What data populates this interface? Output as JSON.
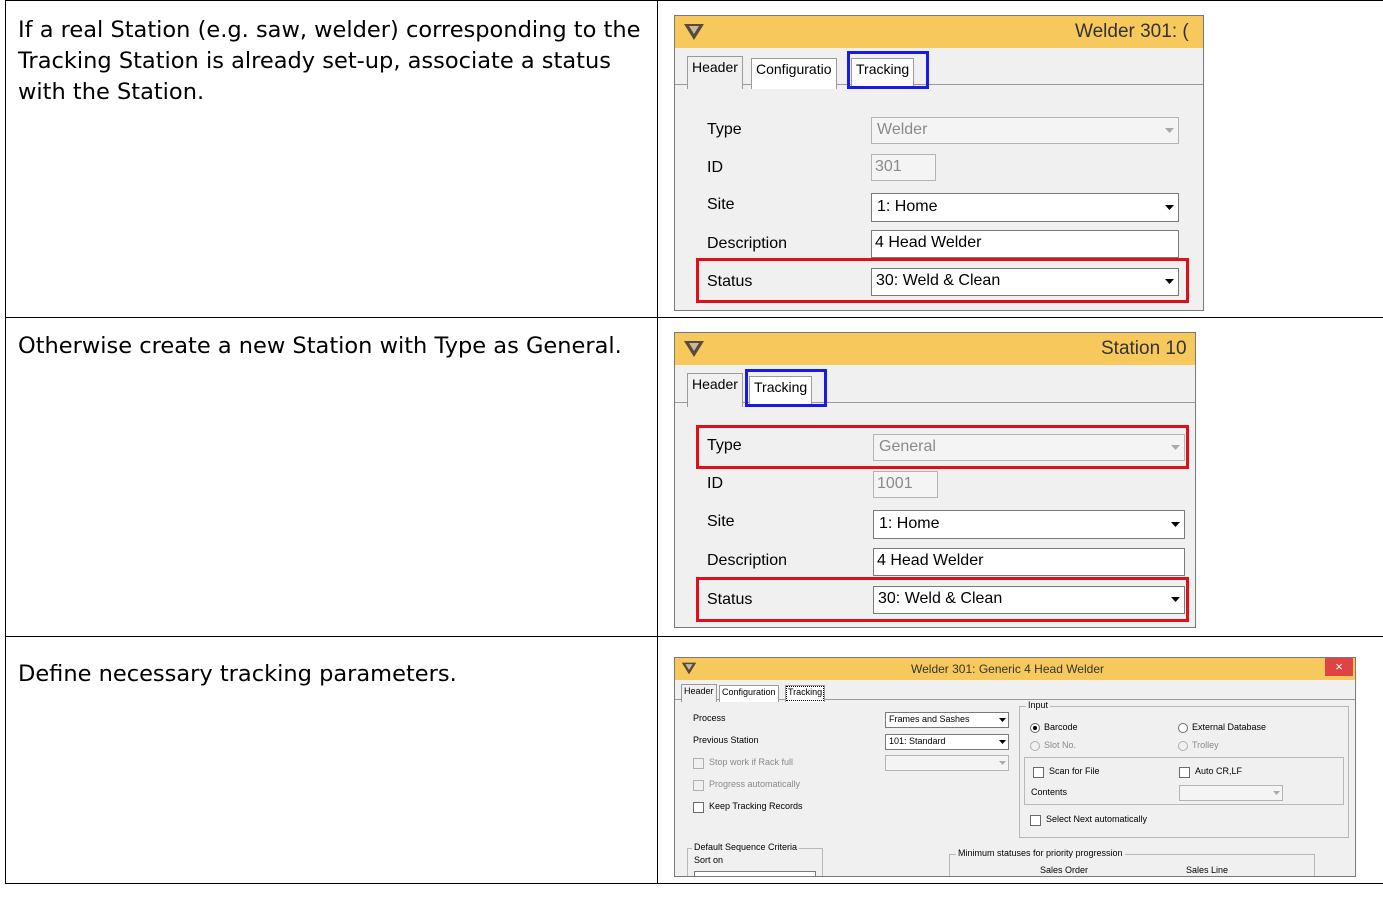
{
  "rows": [
    {
      "text": "If a real Station (e.g. saw, welder) corresponding to the Tracking Station is already set-up, associate a status with the Station.",
      "window": {
        "title": "Welder 301: (",
        "tabs": [
          "Header",
          "Configuratio",
          "Tracking"
        ],
        "labels": {
          "type": "Type",
          "id": "ID",
          "site": "Site",
          "description": "Description",
          "status": "Status"
        },
        "values": {
          "type": "Welder",
          "id": "301",
          "site": "1: Home",
          "description": "4 Head Welder",
          "status": "30: Weld & Clean"
        }
      }
    },
    {
      "text": "Otherwise create a new Station with Type as General.",
      "window": {
        "title": "Station 10",
        "tabs": [
          "Header",
          "Tracking"
        ],
        "labels": {
          "type": "Type",
          "id": "ID",
          "site": "Site",
          "description": "Description",
          "status": "Status"
        },
        "values": {
          "type": "General",
          "id": "1001",
          "site": "1: Home",
          "description": "4 Head Welder",
          "status": "30: Weld & Clean"
        }
      }
    },
    {
      "text": "Define necessary tracking parameters.",
      "window": {
        "title": "Welder 301: Generic 4 Head Welder",
        "close": "×",
        "tabs": [
          "Header",
          "Configuration",
          "Tracking"
        ],
        "process_label": "Process",
        "process_value": "Frames and Sashes",
        "previous_station_label": "Previous Station",
        "previous_station_value": "101: Standard",
        "stop_work": "Stop work if Rack full",
        "progress_auto": "Progress automatically",
        "keep_records": "Keep Tracking Records",
        "input_group": "Input",
        "barcode": "Barcode",
        "external_db": "External Database",
        "slot_no": "Slot No.",
        "trolley": "Trolley",
        "scan_for_file": "Scan for File",
        "auto_crlf": "Auto CR,LF",
        "contents": "Contents",
        "select_next": "Select Next automatically",
        "default_seq": "Default Sequence Criteria",
        "sort_on": "Sort on",
        "min_status": "Minimum statuses for priority progression",
        "sales_order": "Sales Order",
        "sales_line": "Sales Line"
      }
    }
  ],
  "colors": {
    "titlebar": "#f7c95d",
    "highlight_red": "#e0101a",
    "highlight_blue": "#1a1ae6",
    "close_button": "#e04343"
  }
}
